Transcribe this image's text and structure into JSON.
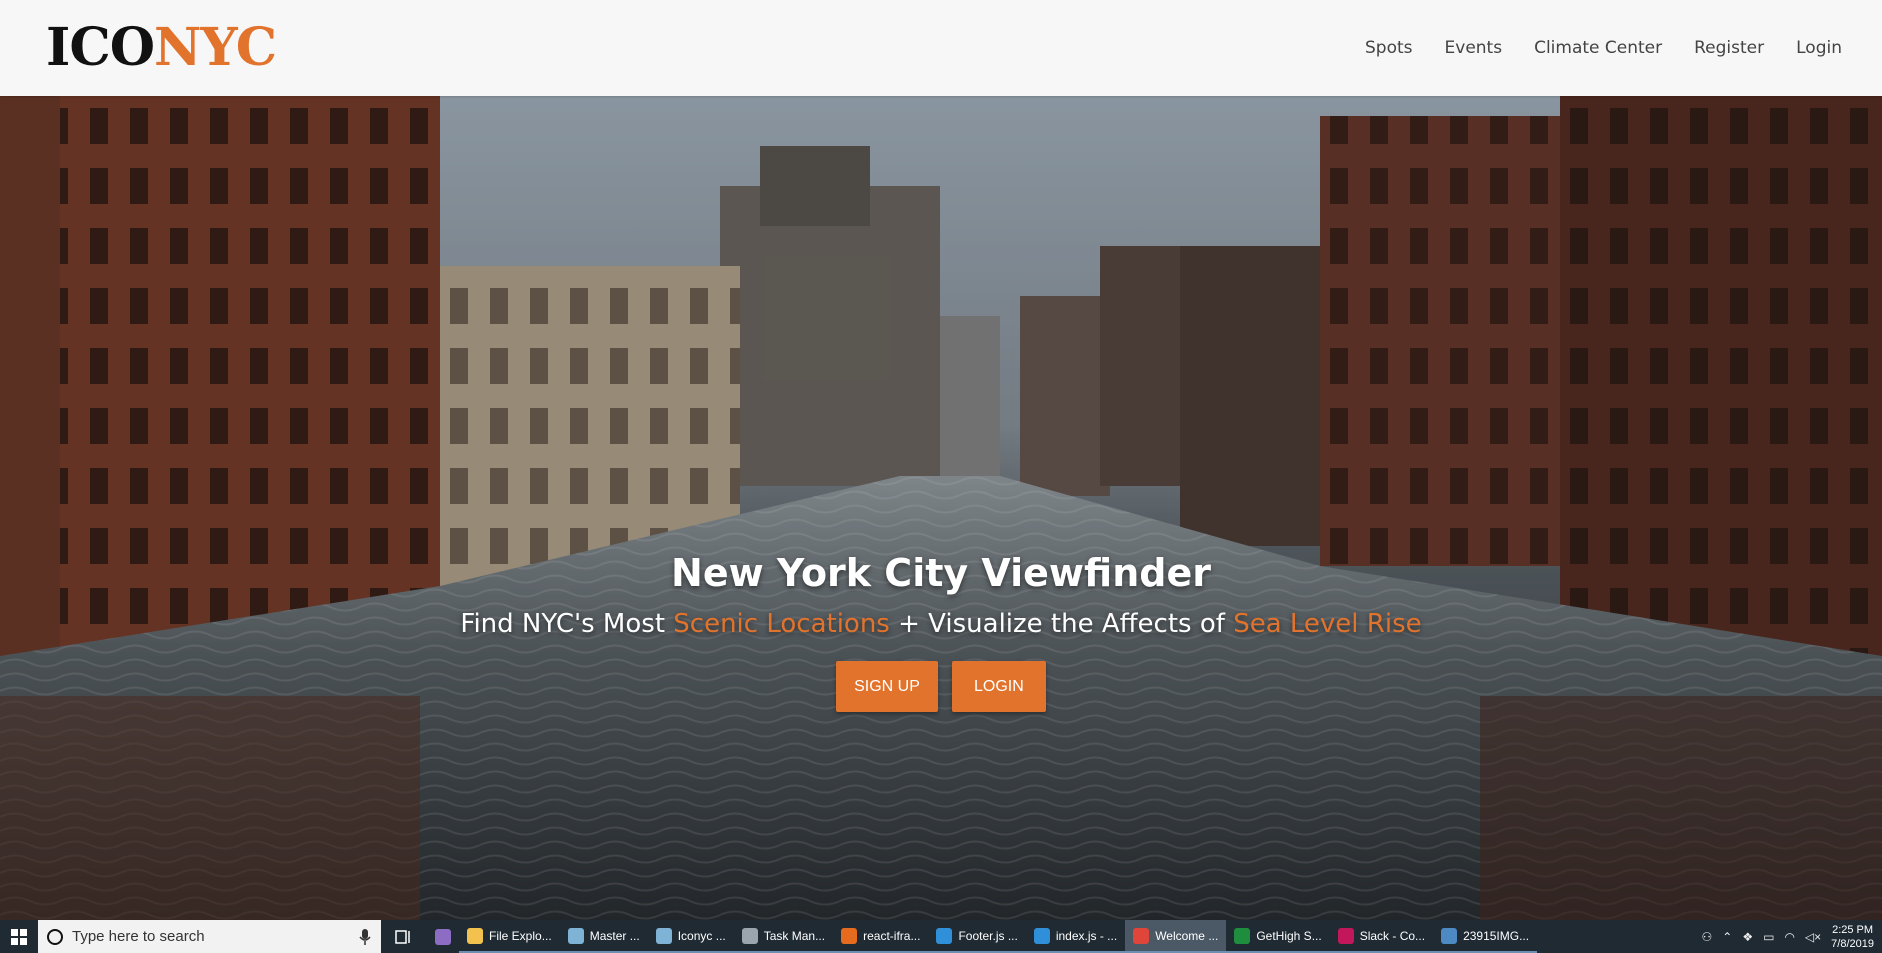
{
  "brand": {
    "logo_part1": "ICO",
    "logo_part2": "NYC"
  },
  "nav": {
    "items": [
      {
        "label": "Spots"
      },
      {
        "label": "Events"
      },
      {
        "label": "Climate Center"
      },
      {
        "label": "Register"
      },
      {
        "label": "Login"
      }
    ]
  },
  "hero": {
    "title": "New York City Viewfinder",
    "subtitle_part1": "Find NYC's Most ",
    "subtitle_accent1": "Scenic Locations",
    "subtitle_part2": " + Visualize the Affects of ",
    "subtitle_accent2": "Sea Level Rise",
    "signup_label": "SIGN UP",
    "login_label": "LOGIN"
  },
  "taskbar": {
    "search_placeholder": "Type here to search",
    "apps": [
      {
        "label": "",
        "color": "#8d6cc4",
        "plain": true
      },
      {
        "label": "File Explo...",
        "color": "#f2c14e"
      },
      {
        "label": "Master ...",
        "color": "#7fb3d5"
      },
      {
        "label": "Iconyc ...",
        "color": "#7fb3d5"
      },
      {
        "label": "Task Man...",
        "color": "#9aa5ae"
      },
      {
        "label": "react-ifra...",
        "color": "#e66b1e"
      },
      {
        "label": "Footer.js ...",
        "color": "#2f8fd8"
      },
      {
        "label": "index.js - ...",
        "color": "#2f8fd8"
      },
      {
        "label": "Welcome ...",
        "color": "#e0453a",
        "active": true
      },
      {
        "label": "GetHigh S...",
        "color": "#1e8e3e"
      },
      {
        "label": "Slack - Co...",
        "color": "#c2185b"
      },
      {
        "label": "23915IMG...",
        "color": "#4d8ac4"
      }
    ],
    "time": "2:25 PM",
    "date": "7/8/2019"
  },
  "colors": {
    "accent": "#e1732d",
    "nav_bg": "#f7f7f7",
    "taskbar_bg": "#1f2a33"
  }
}
